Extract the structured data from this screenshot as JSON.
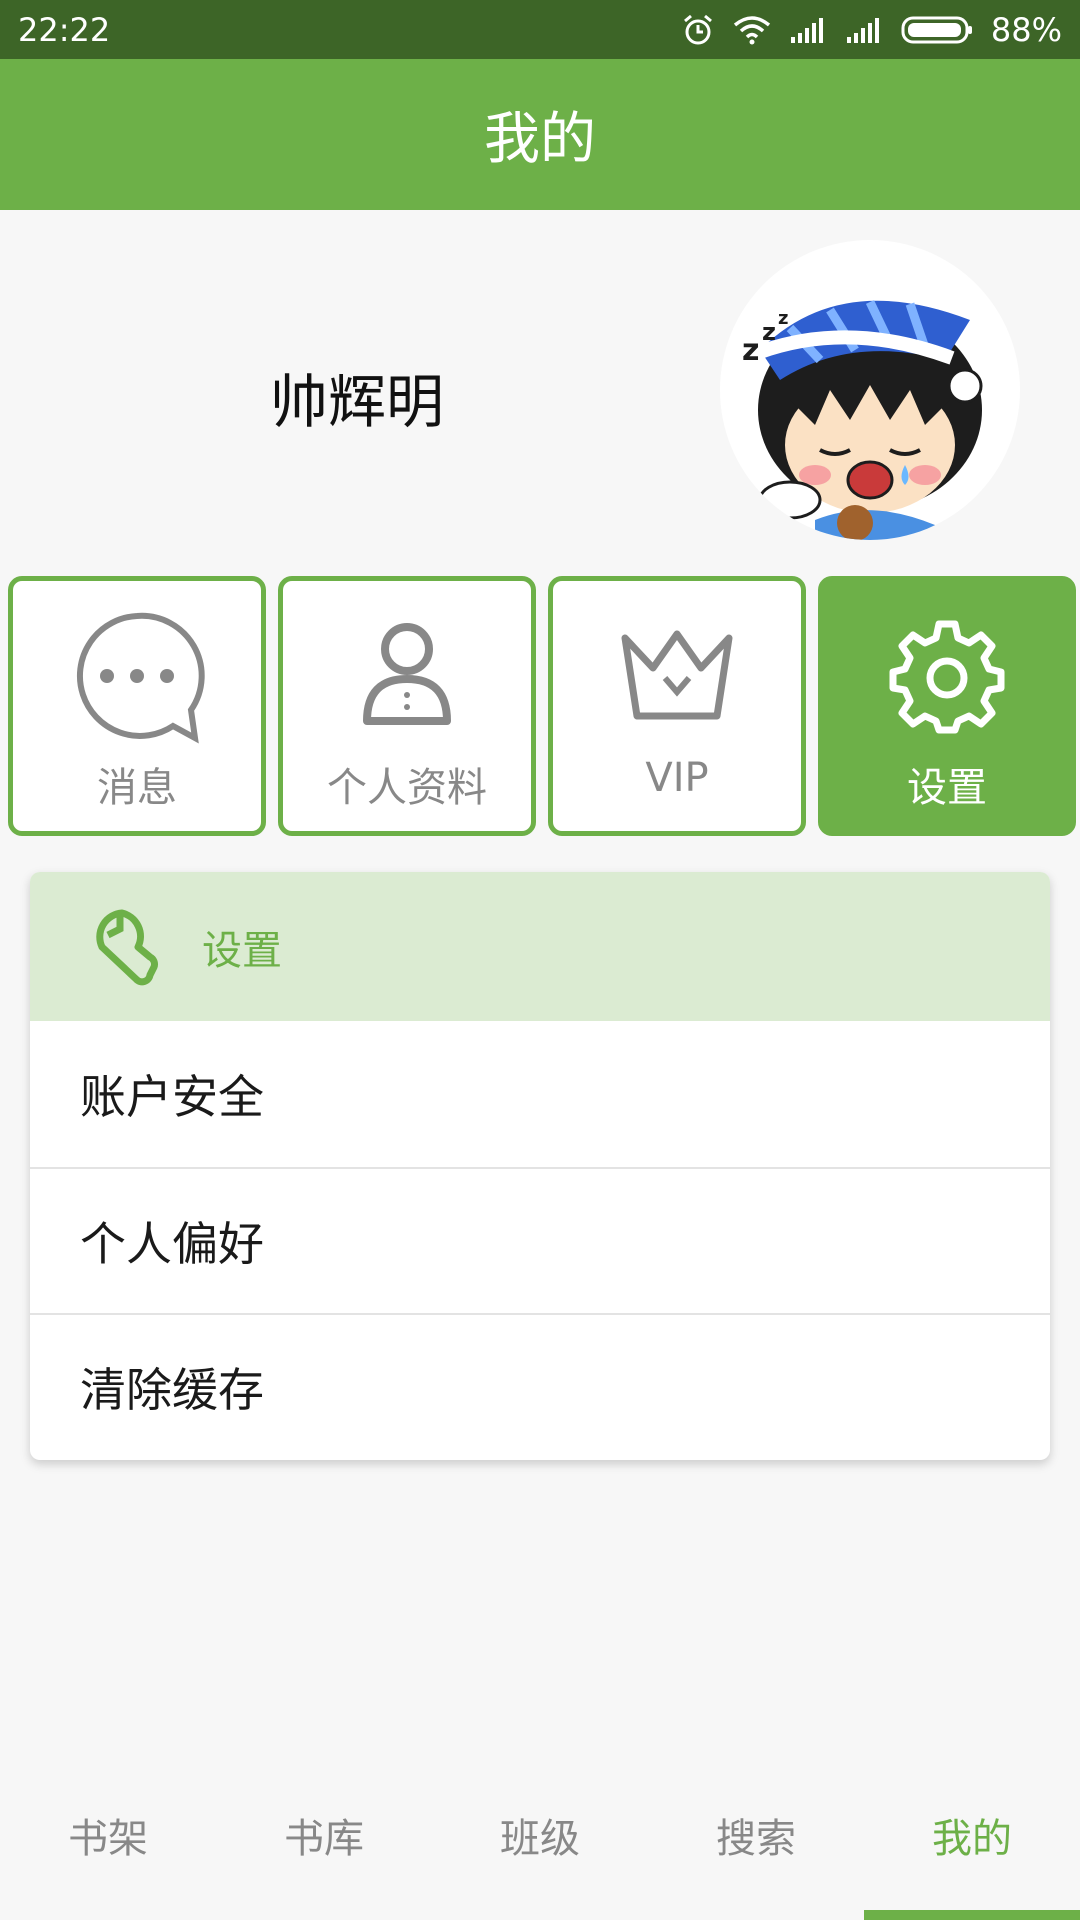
{
  "status_bar": {
    "time": "22:22",
    "battery": "88%"
  },
  "header": {
    "title": "我的"
  },
  "profile": {
    "username": "帅辉明",
    "avatar": "sleepy-boy-avatar"
  },
  "tiles": [
    {
      "label": "消息",
      "icon": "chat-bubble-icon",
      "active": false
    },
    {
      "label": "个人资料",
      "icon": "person-icon",
      "active": false
    },
    {
      "label": "VIP",
      "icon": "crown-icon",
      "active": false
    },
    {
      "label": "设置",
      "icon": "gear-icon",
      "active": true
    }
  ],
  "settings": {
    "title": "设置",
    "icon": "wrench-icon",
    "items": [
      "账户安全",
      "个人偏好",
      "清除缓存"
    ]
  },
  "bottom_nav": {
    "items": [
      "书架",
      "书库",
      "班级",
      "搜索",
      "我的"
    ],
    "active": "我的"
  },
  "colors": {
    "primary": "#6db048",
    "status_bar": "#3d6527",
    "settings_header_bg": "#dbebd2"
  }
}
